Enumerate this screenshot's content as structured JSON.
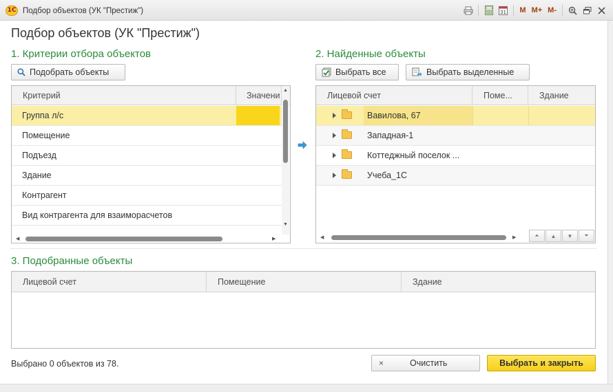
{
  "window": {
    "title": "Подбор объектов (УК \"Престиж\")",
    "logo_text": "1С",
    "toolbar": {
      "m": "M",
      "m_plus": "M+",
      "m_minus": "M-",
      "calendar_day": "31"
    }
  },
  "form": {
    "title": "Подбор объектов (УК \"Престиж\")"
  },
  "criteria": {
    "section_title": "1. Критерии отбора объектов",
    "select_button": "Подобрать объекты",
    "columns": [
      "Критерий",
      "Значени"
    ],
    "rows": [
      "Группа л/с",
      "Помещение",
      "Подъезд",
      "Здание",
      "Контрагент",
      "Вид контрагента для взаиморасчетов"
    ]
  },
  "found": {
    "section_title": "2. Найденные объекты",
    "select_all_button": "Выбрать все",
    "select_selected_button": "Выбрать выделенные",
    "columns": [
      "Лицевой счет",
      "Поме...",
      "Здание"
    ],
    "rows": [
      "Вавилова, 67",
      "Западная-1",
      "Коттеджный поселок ...",
      "Учеба_1С"
    ]
  },
  "picked": {
    "section_title": "3. Подобранные объекты",
    "columns": [
      "Лицевой счет",
      "Помещение",
      "Здание"
    ]
  },
  "footer": {
    "status": "Выбрано 0 объектов из 78.",
    "clear_icon": "×",
    "clear_button": "Очистить",
    "confirm_button": "Выбрать и закрыть"
  },
  "colors": {
    "accent_green": "#2a8c3c",
    "selected_row": "#fbeea5",
    "primary_button": "#f7cf17",
    "value_cell": "#f9d51c"
  }
}
